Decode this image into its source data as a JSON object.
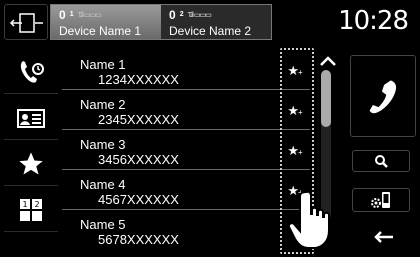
{
  "header": {
    "devices": [
      {
        "number": "0",
        "slot": "1",
        "signal": "T.il ▭▭▭",
        "name": "Device Name 1",
        "selected": true
      },
      {
        "number": "0",
        "slot": "2",
        "signal": "T.il ▭▭▭",
        "name": "Device Name 2",
        "selected": false
      }
    ],
    "clock": "10:28"
  },
  "sidebar": {
    "items": [
      {
        "icon": "recent-calls-icon"
      },
      {
        "icon": "contacts-card-icon"
      },
      {
        "icon": "star-icon"
      },
      {
        "icon": "dialpad-icon"
      }
    ]
  },
  "contacts": [
    {
      "name": "Name 1",
      "number": "1234XXXXXX"
    },
    {
      "name": "Name 2",
      "number": "2345XXXXXX"
    },
    {
      "name": "Name 3",
      "number": "3456XXXXXX"
    },
    {
      "name": "Name 4",
      "number": "4567XXXXXX"
    },
    {
      "name": "Name 5",
      "number": "5678XXXXXX"
    }
  ],
  "favorite_button": {
    "star": "★",
    "plus": "+"
  },
  "scroll": {
    "position": 0.0,
    "visible_fraction": 0.38
  },
  "right_panel": {
    "call": "phone-handset-icon",
    "search": "search-icon",
    "settings": "phone-settings-icon",
    "back": "back-arrow-icon"
  },
  "colors": {
    "background": "#000000",
    "selected_tab": "#8a8a8a",
    "divider": "#6a6a6a",
    "text": "#ffffff"
  }
}
